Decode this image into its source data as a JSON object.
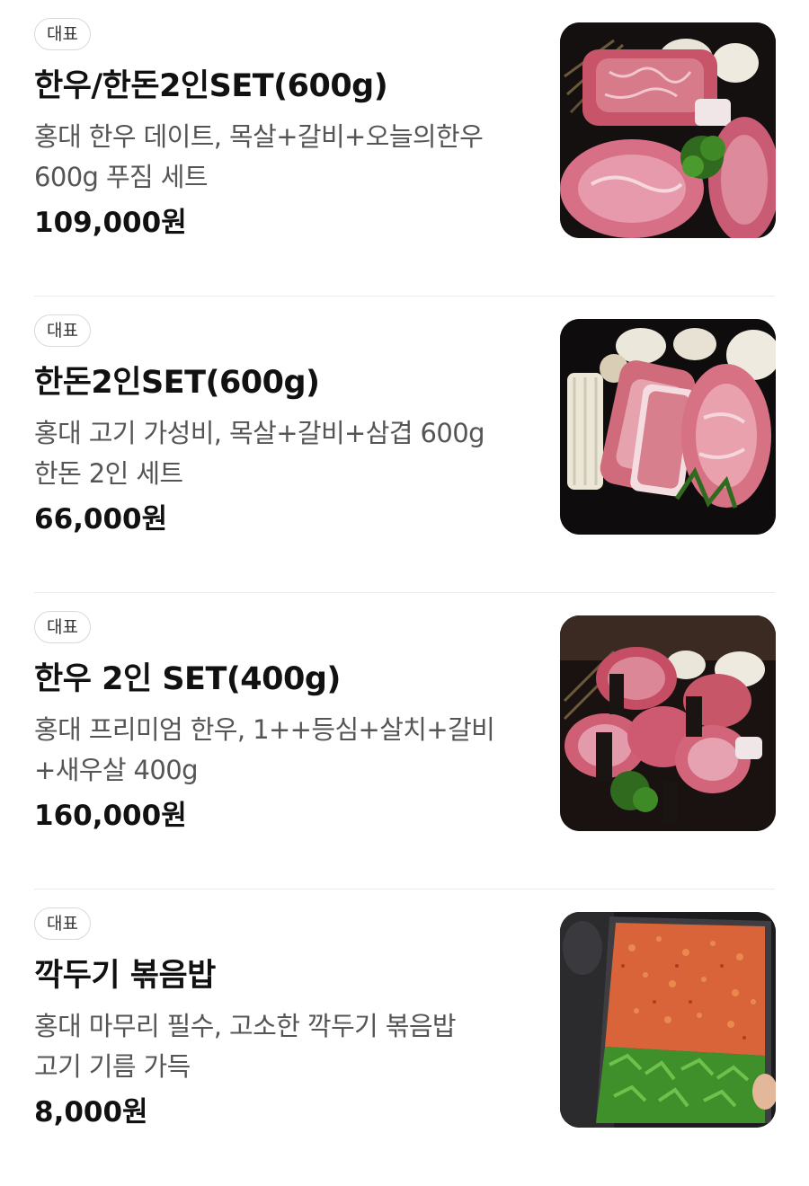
{
  "menu": {
    "items": [
      {
        "badge": "대표",
        "name": "한우/한돈2인SET(600g)",
        "description_lines": [
          "홍대 한우 데이트, 목살+갈비+오늘의한우",
          "600g 푸짐 세트"
        ],
        "price": "109,000원",
        "image_icon": "hanwoo-hanpork-set-photo"
      },
      {
        "badge": "대표",
        "name": "한돈2인SET(600g)",
        "description_lines": [
          "홍대 고기 가성비, 목살+갈비+삼겹 600g",
          "한돈 2인 세트"
        ],
        "price": "66,000원",
        "image_icon": "hanpork-set-photo"
      },
      {
        "badge": "대표",
        "name": "한우 2인 SET(400g)",
        "description_lines": [
          "홍대 프리미엄 한우, 1++등심+살치+갈비",
          "+새우살 400g"
        ],
        "price": "160,000원",
        "image_icon": "hanwoo-premium-set-photo"
      },
      {
        "badge": "대표",
        "name": "깍두기 볶음밥",
        "description_lines": [
          "홍대 마무리 필수, 고소한 깍두기 볶음밥",
          "고기 기름 가득"
        ],
        "price": "8,000원",
        "image_icon": "kkakdugi-fried-rice-photo"
      }
    ]
  },
  "colors": {
    "text_primary": "#111111",
    "text_secondary": "#555555",
    "badge_border": "#d9d9d9",
    "divider": "#ececec"
  }
}
